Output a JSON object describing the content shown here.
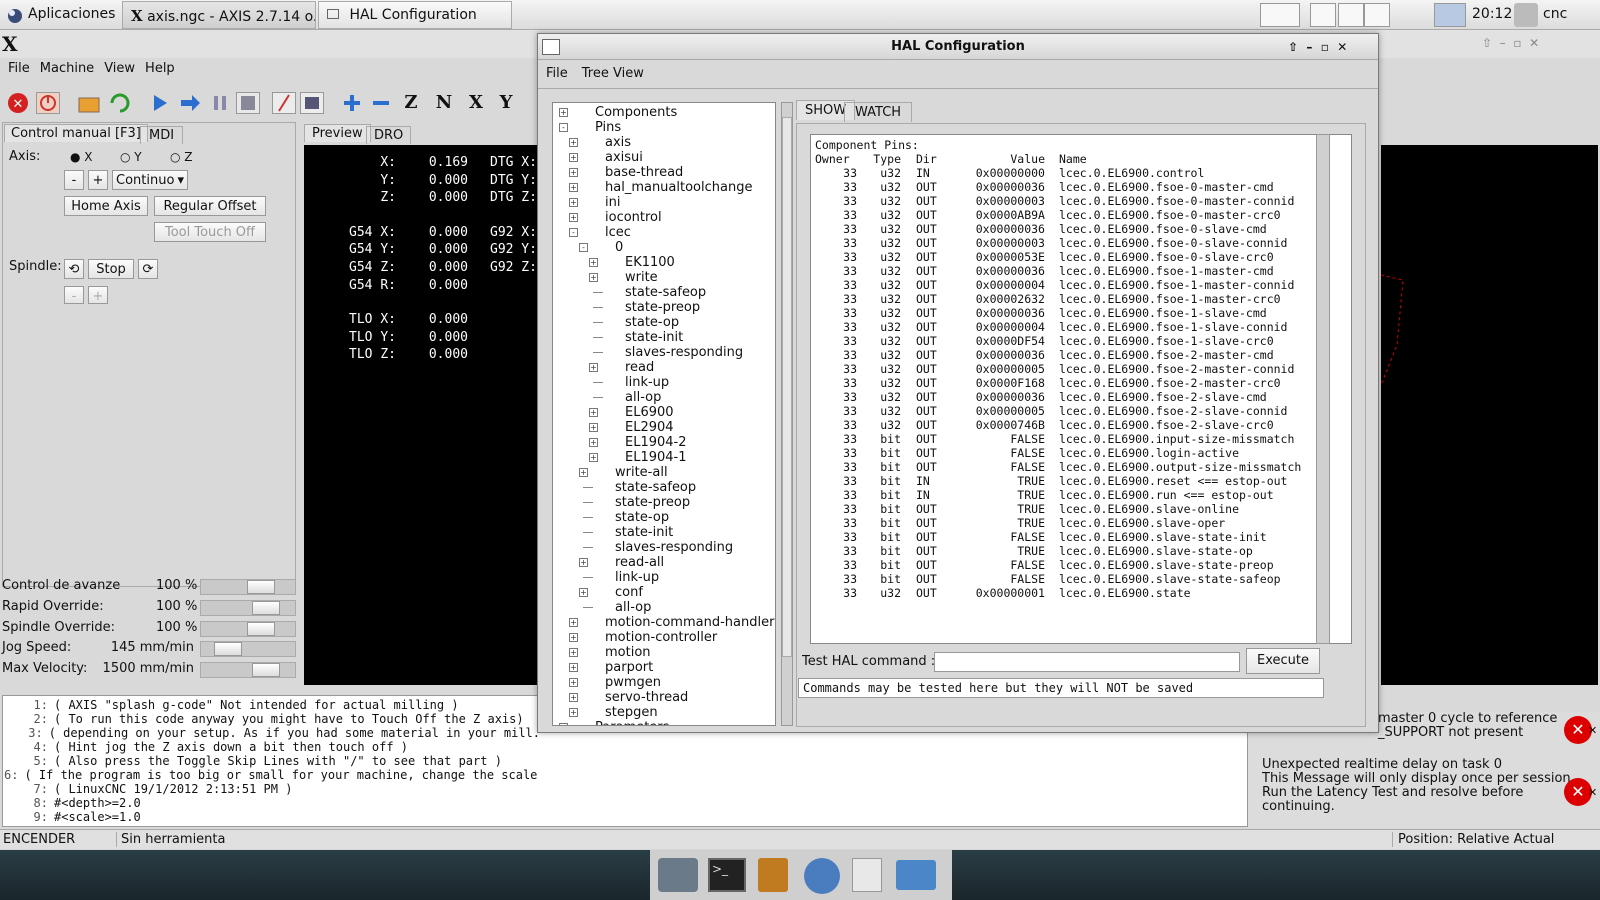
{
  "top_panel": {
    "apps_label": "Aplicaciones",
    "task1": "axis.ngc - AXIS 2.7.14 o...",
    "task2": "HAL Configuration",
    "clock": "20:12",
    "user": "cnc"
  },
  "axis": {
    "logo": "X",
    "menu": [
      "File",
      "Machine",
      "View",
      "Help"
    ],
    "tabs": {
      "manual": "Control manual [F3]",
      "mdi": "MDI"
    },
    "axis_label": "Axis:",
    "axis_options": [
      "X",
      "Y",
      "Z"
    ],
    "jog_minus": "-",
    "jog_plus": "+",
    "jog_mode": "Continuo",
    "home_axis": "Home Axis",
    "regular_offset": "Regular Offset",
    "tool_touch_off": "Tool Touch Off",
    "spindle_label": "Spindle:",
    "spindle_stop": "Stop",
    "spindle_minus": "-",
    "spindle_plus": "+",
    "preview_tabs": {
      "preview": "Preview",
      "dro": "DRO"
    },
    "dro": [
      {
        "l": "X:",
        "v": "0.169",
        "d": "DTG X:"
      },
      {
        "l": "Y:",
        "v": "0.000",
        "d": "DTG Y:"
      },
      {
        "l": "Z:",
        "v": "0.000",
        "d": "DTG Z:"
      },
      {
        "l": "G54 X:",
        "v": "0.000",
        "d": "G92 X:"
      },
      {
        "l": "G54 Y:",
        "v": "0.000",
        "d": "G92 Y:"
      },
      {
        "l": "G54 Z:",
        "v": "0.000",
        "d": "G92 Z:"
      },
      {
        "l": "G54 R:",
        "v": "0.000",
        "d": ""
      },
      {
        "l": "TLO X:",
        "v": "0.000",
        "d": ""
      },
      {
        "l": "TLO Y:",
        "v": "0.000",
        "d": ""
      },
      {
        "l": "TLO Z:",
        "v": "0.000",
        "d": ""
      }
    ],
    "overrides": [
      {
        "label": "Control de avanze",
        "value": "100 %",
        "level": 0.7
      },
      {
        "label": "Rapid Override:",
        "value": "100 %",
        "level": 0.77
      },
      {
        "label": "Spindle Override:",
        "value": "100 %",
        "level": 0.7
      },
      {
        "label": "Jog Speed:",
        "value": "145 mm/min",
        "level": 0.2
      },
      {
        "label": "Max Velocity:",
        "value": "1500 mm/min",
        "level": 0.77
      }
    ],
    "gcode": [
      {
        "n": "1:",
        "t": "( AXIS \"splash g-code\" Not intended for actual milling )"
      },
      {
        "n": "2:",
        "t": "( To run this code anyway you might have to Touch Off the Z axis)"
      },
      {
        "n": "3:",
        "t": "( depending on your setup. As if you had some material in your mill."
      },
      {
        "n": "4:",
        "t": "( Hint jog the Z axis down a bit then touch off )"
      },
      {
        "n": "5:",
        "t": "( Also press the Toggle Skip Lines with \"/\" to see that part )"
      },
      {
        "n": "6:",
        "t": "( If the program is too big or small for your machine, change the scale below )"
      },
      {
        "n": "7:",
        "t": "( LinuxCNC 19/1/2012 2:13:51 PM )"
      },
      {
        "n": "8:",
        "t": "#<depth>=2.0"
      },
      {
        "n": "9:",
        "t": "#<scale>=1.0"
      }
    ],
    "notifications": [
      {
        "text": "master 0 cycle to reference\n_SUPPORT not present"
      },
      {
        "text": "Unexpected realtime delay on task 0\nThis Message will only display once per session.\nRun the Latency Test and resolve before\ncontinuing."
      }
    ],
    "status": {
      "state": "ENCENDER",
      "tool": "Sin herramienta",
      "position": "Position: Relative Actual"
    }
  },
  "hal": {
    "title": "HAL Configuration",
    "menu": [
      "File",
      "Tree View"
    ],
    "tabs": {
      "show": "SHOW",
      "watch": "WATCH"
    },
    "tree": [
      {
        "t": "Components",
        "lv": 0,
        "b": "+"
      },
      {
        "t": "Pins",
        "lv": 0,
        "b": "-"
      },
      {
        "t": "axis",
        "lv": 1,
        "b": "+"
      },
      {
        "t": "axisui",
        "lv": 1,
        "b": "+"
      },
      {
        "t": "base-thread",
        "lv": 1,
        "b": "+"
      },
      {
        "t": "hal_manualtoolchange",
        "lv": 1,
        "b": "+"
      },
      {
        "t": "ini",
        "lv": 1,
        "b": "+"
      },
      {
        "t": "iocontrol",
        "lv": 1,
        "b": "+"
      },
      {
        "t": "lcec",
        "lv": 1,
        "b": "-"
      },
      {
        "t": "0",
        "lv": 2,
        "b": "-"
      },
      {
        "t": "EK1100",
        "lv": 3,
        "b": "+"
      },
      {
        "t": "write",
        "lv": 3,
        "b": "+"
      },
      {
        "t": "state-safeop",
        "lv": 3,
        "b": ""
      },
      {
        "t": "state-preop",
        "lv": 3,
        "b": ""
      },
      {
        "t": "state-op",
        "lv": 3,
        "b": ""
      },
      {
        "t": "state-init",
        "lv": 3,
        "b": ""
      },
      {
        "t": "slaves-responding",
        "lv": 3,
        "b": ""
      },
      {
        "t": "read",
        "lv": 3,
        "b": "+"
      },
      {
        "t": "link-up",
        "lv": 3,
        "b": ""
      },
      {
        "t": "all-op",
        "lv": 3,
        "b": ""
      },
      {
        "t": "EL6900",
        "lv": 3,
        "b": "+"
      },
      {
        "t": "EL2904",
        "lv": 3,
        "b": "+"
      },
      {
        "t": "EL1904-2",
        "lv": 3,
        "b": "+"
      },
      {
        "t": "EL1904-1",
        "lv": 3,
        "b": "+"
      },
      {
        "t": "write-all",
        "lv": 2,
        "b": "+"
      },
      {
        "t": "state-safeop",
        "lv": 2,
        "b": ""
      },
      {
        "t": "state-preop",
        "lv": 2,
        "b": ""
      },
      {
        "t": "state-op",
        "lv": 2,
        "b": ""
      },
      {
        "t": "state-init",
        "lv": 2,
        "b": ""
      },
      {
        "t": "slaves-responding",
        "lv": 2,
        "b": ""
      },
      {
        "t": "read-all",
        "lv": 2,
        "b": "+"
      },
      {
        "t": "link-up",
        "lv": 2,
        "b": ""
      },
      {
        "t": "conf",
        "lv": 2,
        "b": "+"
      },
      {
        "t": "all-op",
        "lv": 2,
        "b": ""
      },
      {
        "t": "motion-command-handler",
        "lv": 1,
        "b": "+"
      },
      {
        "t": "motion-controller",
        "lv": 1,
        "b": "+"
      },
      {
        "t": "motion",
        "lv": 1,
        "b": "+"
      },
      {
        "t": "parport",
        "lv": 1,
        "b": "+"
      },
      {
        "t": "pwmgen",
        "lv": 1,
        "b": "+"
      },
      {
        "t": "servo-thread",
        "lv": 1,
        "b": "+"
      },
      {
        "t": "stepgen",
        "lv": 1,
        "b": "+"
      },
      {
        "t": "Parameters",
        "lv": 0,
        "b": "+"
      }
    ],
    "pins_title": "Component Pins:",
    "pins_header": [
      "Owner",
      "Type",
      "Dir",
      "Value",
      "Name"
    ],
    "pins": [
      [
        "33",
        "u32",
        "IN",
        "0x00000000",
        "lcec.0.EL6900.control"
      ],
      [
        "33",
        "u32",
        "OUT",
        "0x00000036",
        "lcec.0.EL6900.fsoe-0-master-cmd"
      ],
      [
        "33",
        "u32",
        "OUT",
        "0x00000003",
        "lcec.0.EL6900.fsoe-0-master-connid"
      ],
      [
        "33",
        "u32",
        "OUT",
        "0x0000AB9A",
        "lcec.0.EL6900.fsoe-0-master-crc0"
      ],
      [
        "33",
        "u32",
        "OUT",
        "0x00000036",
        "lcec.0.EL6900.fsoe-0-slave-cmd"
      ],
      [
        "33",
        "u32",
        "OUT",
        "0x00000003",
        "lcec.0.EL6900.fsoe-0-slave-connid"
      ],
      [
        "33",
        "u32",
        "OUT",
        "0x0000053E",
        "lcec.0.EL6900.fsoe-0-slave-crc0"
      ],
      [
        "33",
        "u32",
        "OUT",
        "0x00000036",
        "lcec.0.EL6900.fsoe-1-master-cmd"
      ],
      [
        "33",
        "u32",
        "OUT",
        "0x00000004",
        "lcec.0.EL6900.fsoe-1-master-connid"
      ],
      [
        "33",
        "u32",
        "OUT",
        "0x00002632",
        "lcec.0.EL6900.fsoe-1-master-crc0"
      ],
      [
        "33",
        "u32",
        "OUT",
        "0x00000036",
        "lcec.0.EL6900.fsoe-1-slave-cmd"
      ],
      [
        "33",
        "u32",
        "OUT",
        "0x00000004",
        "lcec.0.EL6900.fsoe-1-slave-connid"
      ],
      [
        "33",
        "u32",
        "OUT",
        "0x0000DF54",
        "lcec.0.EL6900.fsoe-1-slave-crc0"
      ],
      [
        "33",
        "u32",
        "OUT",
        "0x00000036",
        "lcec.0.EL6900.fsoe-2-master-cmd"
      ],
      [
        "33",
        "u32",
        "OUT",
        "0x00000005",
        "lcec.0.EL6900.fsoe-2-master-connid"
      ],
      [
        "33",
        "u32",
        "OUT",
        "0x0000F168",
        "lcec.0.EL6900.fsoe-2-master-crc0"
      ],
      [
        "33",
        "u32",
        "OUT",
        "0x00000036",
        "lcec.0.EL6900.fsoe-2-slave-cmd"
      ],
      [
        "33",
        "u32",
        "OUT",
        "0x00000005",
        "lcec.0.EL6900.fsoe-2-slave-connid"
      ],
      [
        "33",
        "u32",
        "OUT",
        "0x0000746B",
        "lcec.0.EL6900.fsoe-2-slave-crc0"
      ],
      [
        "33",
        "bit",
        "OUT",
        "FALSE",
        "lcec.0.EL6900.input-size-missmatch"
      ],
      [
        "33",
        "bit",
        "OUT",
        "FALSE",
        "lcec.0.EL6900.login-active"
      ],
      [
        "33",
        "bit",
        "OUT",
        "FALSE",
        "lcec.0.EL6900.output-size-missmatch"
      ],
      [
        "33",
        "bit",
        "IN",
        "TRUE",
        "lcec.0.EL6900.reset <== estop-out"
      ],
      [
        "33",
        "bit",
        "IN",
        "TRUE",
        "lcec.0.EL6900.run <== estop-out"
      ],
      [
        "33",
        "bit",
        "OUT",
        "TRUE",
        "lcec.0.EL6900.slave-online"
      ],
      [
        "33",
        "bit",
        "OUT",
        "TRUE",
        "lcec.0.EL6900.slave-oper"
      ],
      [
        "33",
        "bit",
        "OUT",
        "FALSE",
        "lcec.0.EL6900.slave-state-init"
      ],
      [
        "33",
        "bit",
        "OUT",
        "TRUE",
        "lcec.0.EL6900.slave-state-op"
      ],
      [
        "33",
        "bit",
        "OUT",
        "FALSE",
        "lcec.0.EL6900.slave-state-preop"
      ],
      [
        "33",
        "bit",
        "OUT",
        "FALSE",
        "lcec.0.EL6900.slave-state-safeop"
      ],
      [
        "33",
        "u32",
        "OUT",
        "0x00000001",
        "lcec.0.EL6900.state"
      ]
    ],
    "cmd_label": "Test HAL command :",
    "cmd_value": "",
    "execute": "Execute",
    "cmd_note": "Commands may be tested here but they will NOT be saved"
  }
}
